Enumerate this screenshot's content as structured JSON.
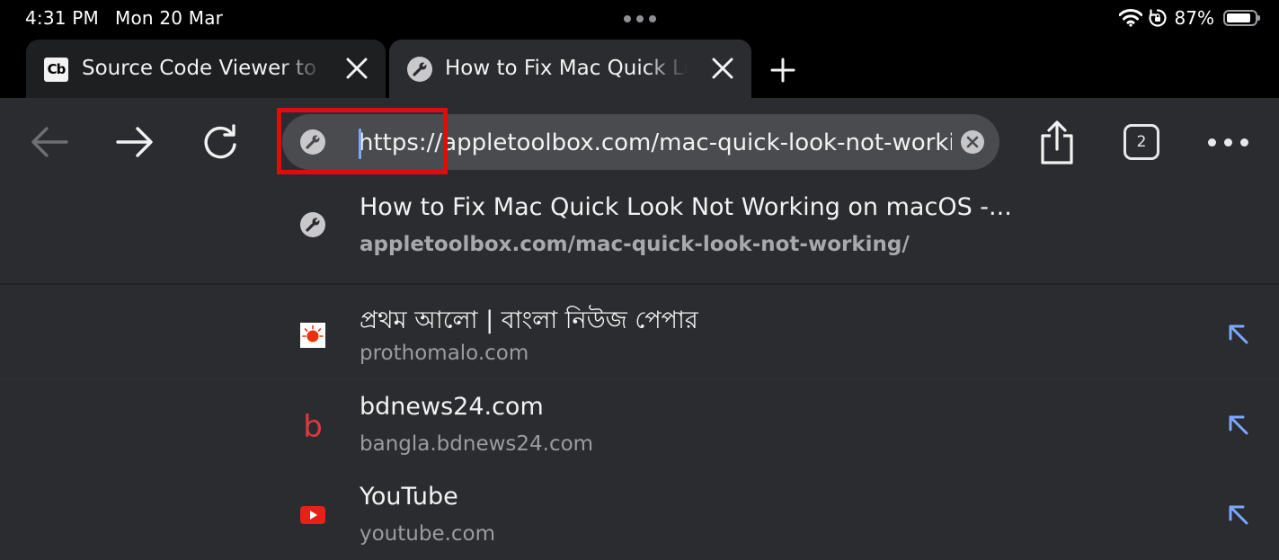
{
  "status_bar": {
    "time": "4:31 PM",
    "date": "Mon 20 Mar",
    "battery": "87%",
    "battery_level": 0.87
  },
  "tabs": [
    {
      "title": "Source Code Viewer to View",
      "favicon": "cb-logo-icon",
      "active": false
    },
    {
      "title": "How to Fix Mac Quick Look Not Working",
      "favicon": "wrench-icon",
      "active": true
    }
  ],
  "toolbar": {
    "back_enabled": false,
    "url": "https://appletoolbox.com/mac-quick-look-not-working/",
    "tab_count": "2"
  },
  "suggestions": {
    "top_hit": {
      "title": "How to Fix Mac Quick Look Not Working on macOS -...",
      "url": "appletoolbox.com/mac-quick-look-not-working/",
      "icon": "wrench-icon"
    },
    "items": [
      {
        "title": "প্রথম আলো | বাংলা নিউজ পেপার",
        "url": "prothomalo.com",
        "icon": "prothomalo-sun-icon"
      },
      {
        "title": "bdnews24.com",
        "url": "bangla.bdnews24.com",
        "icon": "bdnews-b-icon",
        "letter": "b"
      },
      {
        "title": "YouTube",
        "url": "youtube.com",
        "icon": "youtube-icon"
      }
    ]
  },
  "colors": {
    "background": "#2b2c2f",
    "topbar": "#000000",
    "omnibox": "#4a4b4f",
    "highlight": "#e00b0b",
    "append_arrow": "#7aa7ff",
    "caret": "#7aa7ff"
  }
}
